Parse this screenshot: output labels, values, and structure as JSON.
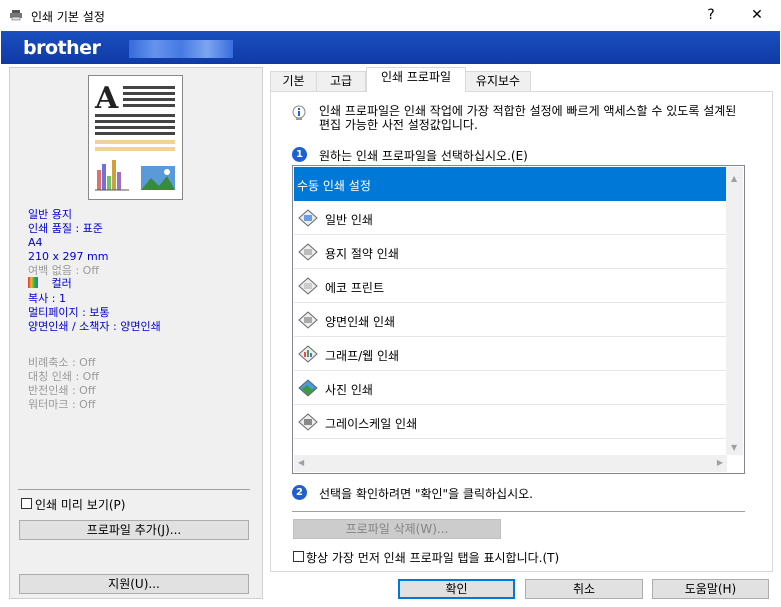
{
  "window": {
    "title": "인쇄 기본 설정",
    "help": "?",
    "close": "✕"
  },
  "brand": {
    "logo": "brother"
  },
  "left": {
    "info_blue": [
      "일반 용지",
      "인쇄 품질 : 표준",
      "A4",
      "210 x 297 mm"
    ],
    "info_gray1": "여백 없음 : Off",
    "color_label": "컬러",
    "info_blue2": [
      "복사 : 1",
      "멀티페이지 : 보통",
      "양면인쇄 / 소책자 : 양면인쇄"
    ],
    "info_gray2": [
      "비례축소 : Off",
      "대칭 인쇄 : Off",
      "반전인쇄 : Off",
      "워터마크 : Off"
    ],
    "preview_check": "인쇄 미리 보기(P)",
    "add_profile": "프로파일 추가(J)...",
    "support": "지원(U)..."
  },
  "tabs": [
    "기본",
    "고급",
    "인쇄 프로파일",
    "유지보수"
  ],
  "profile": {
    "description": "인쇄 프로파일은 인쇄 작업에 가장 적합한 설정에 빠르게 액세스할 수 있도록 설계된 편집 가능한 사전 설정값입니다.",
    "step1": "원하는 인쇄 프로파일을 선택하십시오.(E)",
    "items": [
      "수동 인쇄 설정",
      "일반 인쇄",
      "용지 절약 인쇄",
      "에코 프린트",
      "양면인쇄 인쇄",
      "그래프/웹 인쇄",
      "사진 인쇄",
      "그레이스케일 인쇄"
    ],
    "step2": "선택을 확인하려면 \"확인\"을 클릭하십시오.",
    "delete": "프로파일 삭제(W)...",
    "always_show": "항상 가장 먼저 인쇄 프로파일 탭을 표시합니다.(T)"
  },
  "buttons": {
    "ok": "확인",
    "cancel": "취소",
    "help": "도움말(H)"
  },
  "colors": {
    "accent": "#0078d7",
    "brand": "#1b4fbf",
    "info_blue": "#0000d0"
  }
}
